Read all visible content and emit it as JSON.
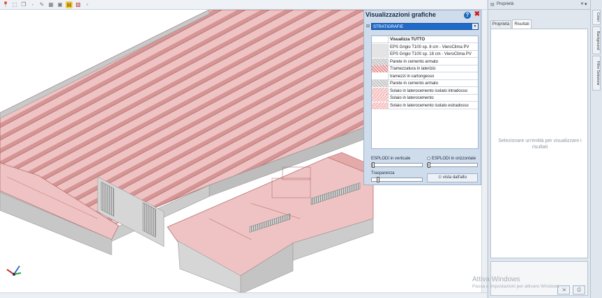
{
  "toolbar": {
    "icons": [
      "pin-icon",
      "select-icon",
      "copy-icon",
      "dash-icon",
      "measure-icon",
      "grid-icon",
      "camera-icon",
      "highlight-icon",
      "image-icon",
      "new-icon"
    ]
  },
  "graphics_panel": {
    "title": "Visualizzazioni grafiche",
    "help_label": "?",
    "close_label": "✖",
    "collapse_symbol": "⊟",
    "dropdown_value": "STRATIGRAFIE",
    "list_header": "Visualizza TUTTO",
    "items": [
      {
        "label": "EPS Grigio T100 sp. 8 cm - VieroClima PV",
        "swatch": "gray"
      },
      {
        "label": "EPS Grigio T100 sp. 18 cm - VieroClima PV",
        "swatch": "gray"
      },
      {
        "label": "Parete in cemento armato",
        "swatch": "hatch"
      },
      {
        "label": "Tramezzatura in laterizio",
        "swatch": "red"
      },
      {
        "label": "tramezzi in cartongesso",
        "swatch": "none"
      },
      {
        "label": "Parete in cemento armato",
        "swatch": "hatch"
      },
      {
        "label": "Solaio in laterocemento isolato intradosso",
        "swatch": "pink"
      },
      {
        "label": "Solaio in laterocemento",
        "swatch": "pink"
      },
      {
        "label": "Solaio in laterocemento isolato estradosso",
        "swatch": "pink"
      }
    ],
    "explode_vertical_label": "ESPLODI in verticale",
    "explode_horizontal_label": "ESPLODI in orizzontale",
    "transparency_label": "Trasparenza",
    "explode_vertical_level": 0,
    "explode_horizontal_level": 0,
    "transparency_level": 0.1,
    "top_view_button": "vista dall'alto"
  },
  "properties_panel": {
    "title": "Proprietà",
    "pin_symbol": "▾",
    "close_symbol": "✕",
    "tabs": [
      {
        "label": "Proprietà",
        "active": false
      },
      {
        "label": "Risultati",
        "active": true
      }
    ],
    "message": "Selezionare un'entità per visualizzare i risultati"
  },
  "side_tabs": [
    "Colori",
    "Background",
    "Filtro Selezione"
  ],
  "watermark": {
    "line1": "Attiva Windows",
    "line2": "Passa a Impostazioni per attivare Windows."
  },
  "colors": {
    "roof_pink": "#eab3b3",
    "roof_stripe": "#d99a9a",
    "wall_gray": "#c9c9c9",
    "selection_blue": "#1f6bc9",
    "panel_bg": "#cfdcec"
  }
}
